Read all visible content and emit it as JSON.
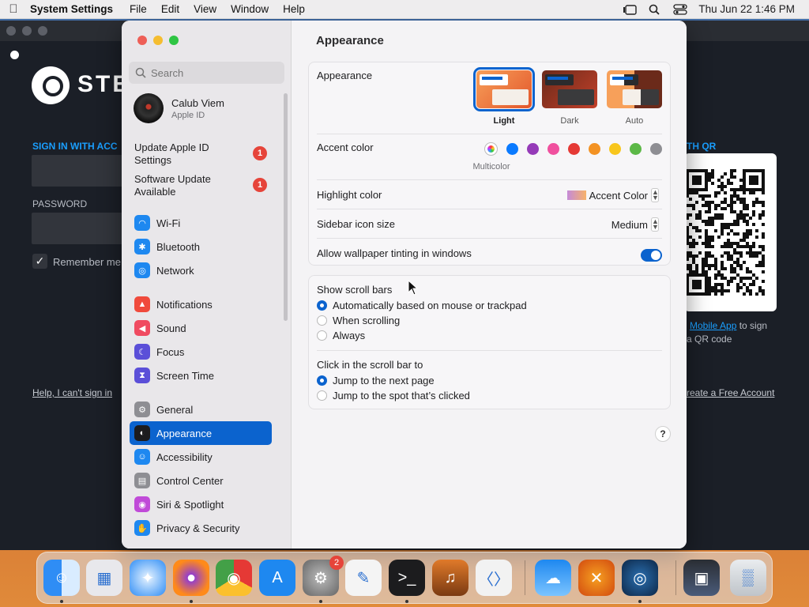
{
  "menubar": {
    "app": "System Settings",
    "menus": [
      "File",
      "Edit",
      "View",
      "Window",
      "Help"
    ],
    "clock": "Thu Jun 22  1:46 PM"
  },
  "steam": {
    "brand": "STEA",
    "sign_in_label": "SIGN IN WITH ACC",
    "password_label": "PASSWORD",
    "remember": "Remember me",
    "help_link": "Help, I can't sign in",
    "qr_label": "TH QR",
    "mobile_link": "Mobile App",
    "mobile_text_1": " to sign",
    "mobile_text_2": "a QR code",
    "create_link": "reate a Free Account"
  },
  "sidebar": {
    "search_placeholder": "Search",
    "profile": {
      "name": "Calub Viem",
      "sub": "Apple ID"
    },
    "updates": [
      {
        "label": "Update Apple ID Settings",
        "badge": "1"
      },
      {
        "label": "Software Update Available",
        "badge": "1"
      }
    ],
    "items": [
      {
        "label": "Wi-Fi",
        "icon": "wifi-icon",
        "color": "#1e88f0"
      },
      {
        "label": "Bluetooth",
        "icon": "bluetooth-icon",
        "color": "#1e88f0"
      },
      {
        "label": "Network",
        "icon": "globe-icon",
        "color": "#1e88f0"
      },
      {
        "label": "Notifications",
        "icon": "bell-icon",
        "color": "#f04a3c"
      },
      {
        "label": "Sound",
        "icon": "speaker-icon",
        "color": "#f04a60"
      },
      {
        "label": "Focus",
        "icon": "moon-icon",
        "color": "#5b4fd8"
      },
      {
        "label": "Screen Time",
        "icon": "hourglass-icon",
        "color": "#5b4fd8"
      },
      {
        "label": "General",
        "icon": "gear-icon",
        "color": "#8e8e93"
      },
      {
        "label": "Appearance",
        "icon": "appearance-icon",
        "color": "#1c1c1e"
      },
      {
        "label": "Accessibility",
        "icon": "accessibility-icon",
        "color": "#1e88f0"
      },
      {
        "label": "Control Center",
        "icon": "switches-icon",
        "color": "#8e8e93"
      },
      {
        "label": "Siri & Spotlight",
        "icon": "siri-icon",
        "color": "#c04ad8"
      },
      {
        "label": "Privacy & Security",
        "icon": "hand-icon",
        "color": "#1e88f0"
      }
    ],
    "selected": "Appearance"
  },
  "main": {
    "title": "Appearance",
    "appearance": {
      "label": "Appearance",
      "options": [
        "Light",
        "Dark",
        "Auto"
      ],
      "selected": "Light"
    },
    "accent": {
      "label": "Accent color",
      "selected_name": "Multicolor",
      "colors": [
        "#0a7aff",
        "#953ab8",
        "#f0509e",
        "#e53935",
        "#f39223",
        "#f8c61c",
        "#5cb847",
        "#8e8e93"
      ]
    },
    "highlight": {
      "label": "Highlight color",
      "value": "Accent Color"
    },
    "icon_size": {
      "label": "Sidebar icon size",
      "value": "Medium"
    },
    "tinting": {
      "label": "Allow wallpaper tinting in windows",
      "on": true
    },
    "scroll_bars": {
      "label": "Show scroll bars",
      "options": [
        "Automatically based on mouse or trackpad",
        "When scrolling",
        "Always"
      ],
      "selected": 0
    },
    "click_scroll": {
      "label": "Click in the scroll bar to",
      "options": [
        "Jump to the next page",
        "Jump to the spot that’s clicked"
      ],
      "selected": 0
    },
    "help": "?"
  },
  "dock": {
    "settings_badge": "2",
    "apps": [
      "finder-icon",
      "launchpad-icon",
      "safari-icon",
      "firefox-icon",
      "chrome-icon",
      "app-store-icon",
      "system-settings-icon",
      "textedit-icon",
      "terminal-icon",
      "garageband-icon",
      "vscode-icon",
      "weather-icon",
      "crossover-icon",
      "steam-icon",
      "screenshot-icon",
      "trash-icon"
    ]
  }
}
